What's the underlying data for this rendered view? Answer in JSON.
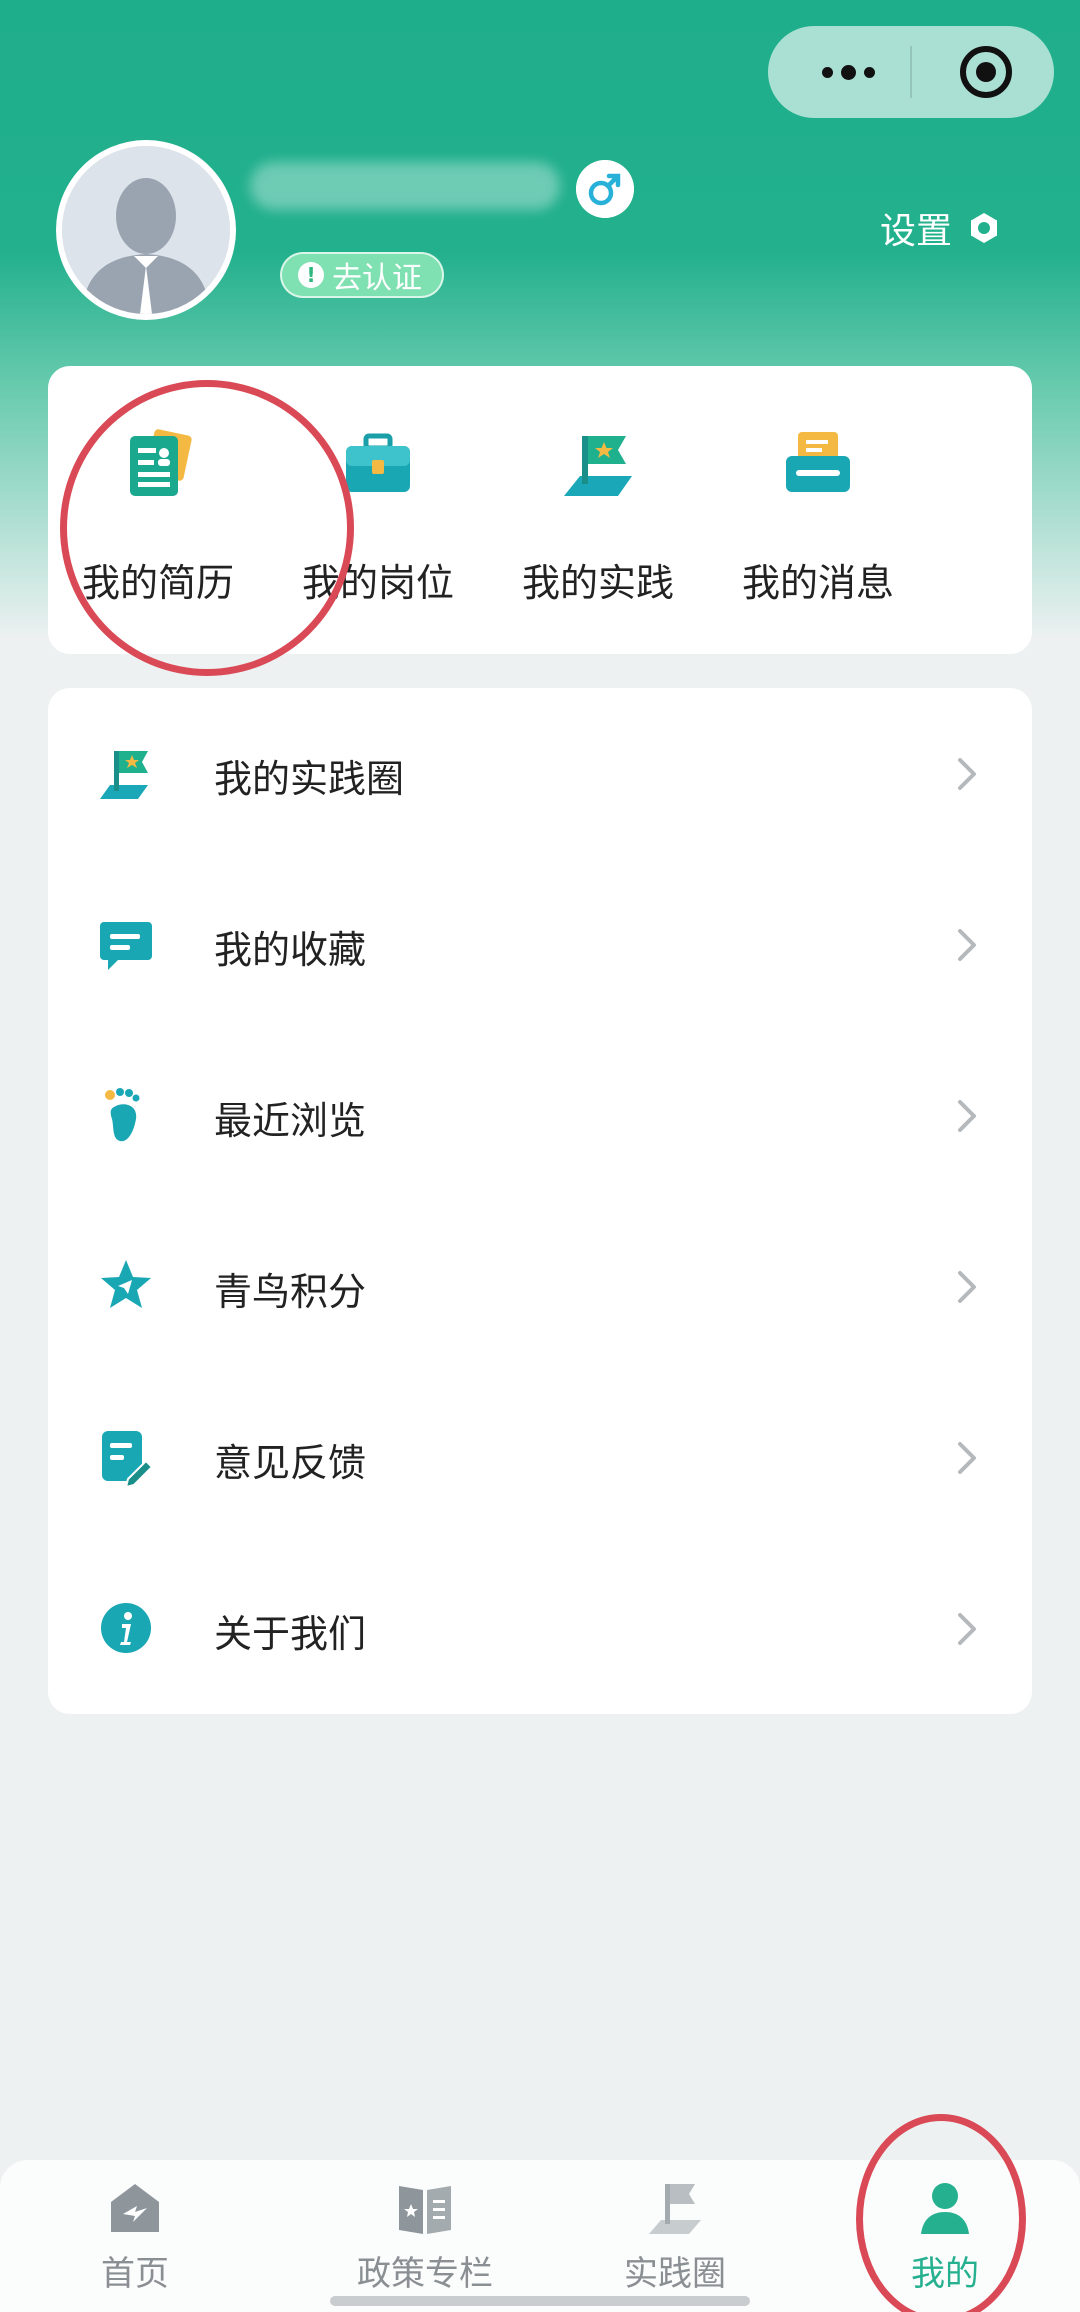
{
  "header": {
    "verify_label": "去认证",
    "verify_icon": "!",
    "settings_label": "设置"
  },
  "quick_actions": [
    {
      "label": "我的简历",
      "icon": "resume-icon"
    },
    {
      "label": "我的岗位",
      "icon": "briefcase-icon"
    },
    {
      "label": "我的实践",
      "icon": "flag-icon"
    },
    {
      "label": "我的消息",
      "icon": "message-tray-icon"
    }
  ],
  "menu": [
    {
      "label": "我的实践圈",
      "icon": "practice-circle-icon"
    },
    {
      "label": "我的收藏",
      "icon": "favorite-chat-icon"
    },
    {
      "label": "最近浏览",
      "icon": "footprint-icon"
    },
    {
      "label": "青鸟积分",
      "icon": "star-bird-icon"
    },
    {
      "label": "意见反馈",
      "icon": "feedback-edit-icon"
    },
    {
      "label": "关于我们",
      "icon": "info-icon"
    }
  ],
  "tabbar": [
    {
      "label": "首页",
      "icon": "home-icon",
      "active": false
    },
    {
      "label": "政策专栏",
      "icon": "policy-book-icon",
      "active": false
    },
    {
      "label": "实践圈",
      "icon": "practice-flag-icon",
      "active": false
    },
    {
      "label": "我的",
      "icon": "user-icon",
      "active": true
    }
  ],
  "colors": {
    "brand": "#22b08d",
    "annotation_circle": "#d94a56"
  }
}
